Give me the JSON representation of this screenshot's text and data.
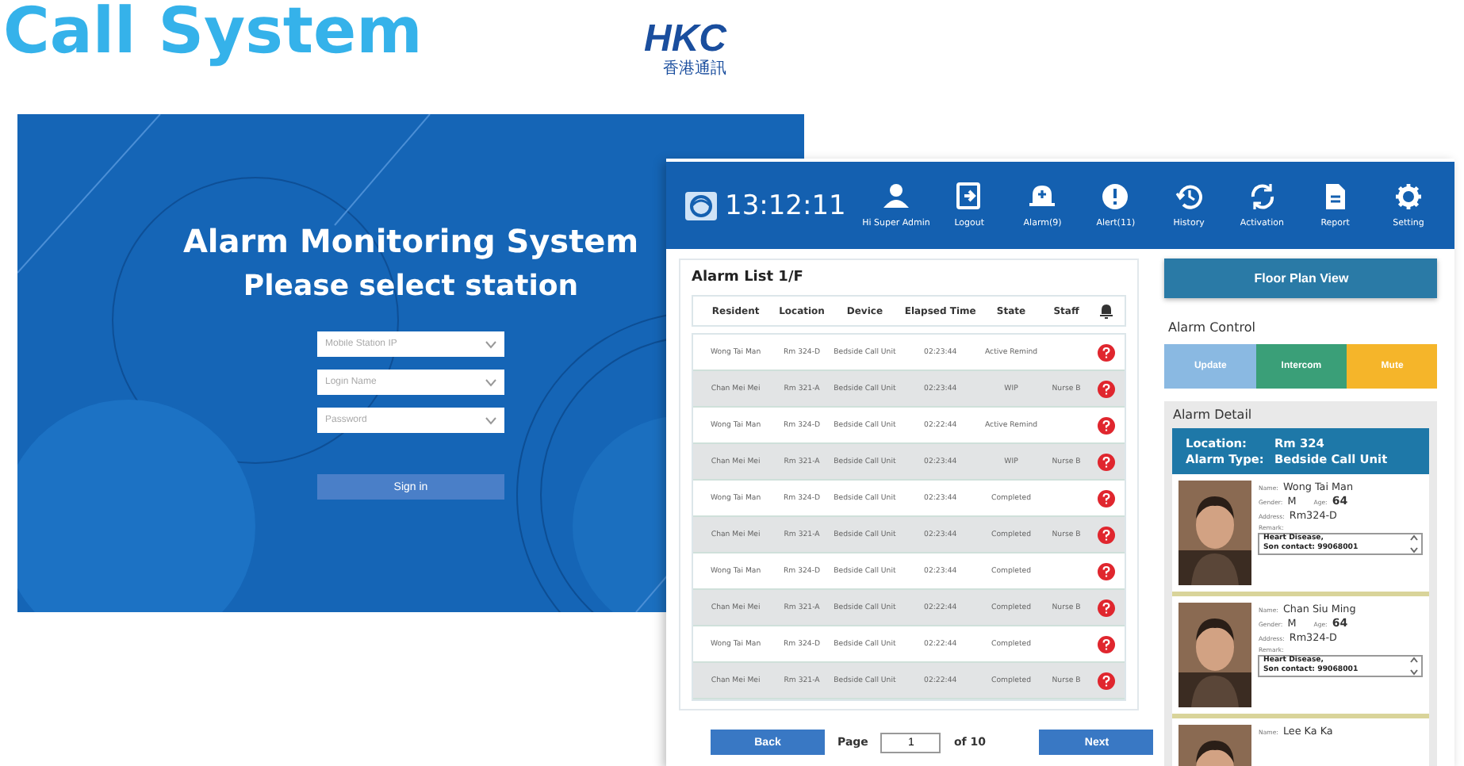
{
  "headline": "Call System",
  "logo": {
    "text": "HKC",
    "subtitle": "香港通訊"
  },
  "login": {
    "title": "Alarm Monitoring System",
    "subtitle": "Please select station",
    "fields": [
      {
        "placeholder": "Mobile Station IP"
      },
      {
        "placeholder": "Login Name"
      },
      {
        "placeholder": "Password"
      }
    ],
    "button": "Sign in"
  },
  "dashboard": {
    "time": "13:12:11",
    "nav": [
      {
        "kind": "user",
        "label": "Hi Super Admin"
      },
      {
        "kind": "logout",
        "label": "Logout"
      },
      {
        "kind": "alarm",
        "label": "Alarm(9)"
      },
      {
        "kind": "alert",
        "label": "Alert(11)"
      },
      {
        "kind": "history",
        "label": "History"
      },
      {
        "kind": "activation",
        "label": "Activation"
      },
      {
        "kind": "report",
        "label": "Report"
      },
      {
        "kind": "setting",
        "label": "Setting"
      }
    ],
    "alarm_list": {
      "title": "Alarm List 1/F",
      "columns": [
        "Resident",
        "Location",
        "Device",
        "Elapsed Time",
        "State",
        "Staff"
      ],
      "rows": [
        {
          "cells": [
            "Wong Tai Man",
            "Rm 324-D",
            "Bedside Call Unit",
            "02:23:44",
            "Active Remind",
            ""
          ]
        },
        {
          "cells": [
            "Chan Mei Mei",
            "Rm 321-A",
            "Bedside Call Unit",
            "02:23:44",
            "WIP",
            "Nurse B"
          ]
        },
        {
          "cells": [
            "Wong Tai Man",
            "Rm 324-D",
            "Bedside Call Unit",
            "02:22:44",
            "Active Remind",
            ""
          ]
        },
        {
          "cells": [
            "Chan Mei Mei",
            "Rm 321-A",
            "Bedside Call Unit",
            "02:23:44",
            "WIP",
            "Nurse B"
          ]
        },
        {
          "cells": [
            "Wong Tai Man",
            "Rm 324-D",
            "Bedside Call Unit",
            "02:23:44",
            "Completed",
            ""
          ]
        },
        {
          "cells": [
            "Chan Mei Mei",
            "Rm 321-A",
            "Bedside Call Unit",
            "02:23:44",
            "Completed",
            "Nurse B"
          ]
        },
        {
          "cells": [
            "Wong Tai Man",
            "Rm 324-D",
            "Bedside Call Unit",
            "02:23:44",
            "Completed",
            ""
          ]
        },
        {
          "cells": [
            "Chan Mei Mei",
            "Rm 321-A",
            "Bedside Call Unit",
            "02:22:44",
            "Completed",
            "Nurse B"
          ]
        },
        {
          "cells": [
            "Wong Tai Man",
            "Rm 324-D",
            "Bedside Call Unit",
            "02:22:44",
            "Completed",
            ""
          ]
        },
        {
          "cells": [
            "Chan Mei Mei",
            "Rm 321-A",
            "Bedside Call Unit",
            "02:22:44",
            "Completed",
            "Nurse B"
          ]
        }
      ],
      "pagination": {
        "back": "Back",
        "page_label": "Page",
        "page": "1",
        "total": "of 10",
        "next": "Next"
      }
    },
    "floor_plan_button": "Floor Plan View",
    "alarm_control": {
      "title": "Alarm Control",
      "buttons": [
        {
          "label": "Update",
          "color": "#8ab9e2"
        },
        {
          "label": "Intercom",
          "color": "#3a9f78"
        },
        {
          "label": "Mute",
          "color": "#f5b52a"
        }
      ]
    },
    "alarm_detail": {
      "title": "Alarm Detail",
      "location_label": "Location:",
      "location": "Rm 324",
      "type_label": "Alarm Type:",
      "type": "Bedside Call Unit",
      "residents": [
        {
          "name_label": "Name:",
          "name": "Wong Tai Man",
          "gender_label": "Gender:",
          "gender": "M",
          "age_label": "Age:",
          "age": "64",
          "address_label": "Address:",
          "address": "Rm324-D",
          "remark_label": "Remark:",
          "remark": "Heart Disease,\nSon contact: 99068001"
        },
        {
          "name_label": "Name:",
          "name": "Chan Siu Ming",
          "gender_label": "Gender:",
          "gender": "M",
          "age_label": "Age:",
          "age": "64",
          "address_label": "Address:",
          "address": "Rm324-D",
          "remark_label": "Remark:",
          "remark": "Heart Disease,\nSon contact: 99068001"
        },
        {
          "name_label": "Name:",
          "name": "Lee Ka Ka"
        }
      ]
    }
  }
}
